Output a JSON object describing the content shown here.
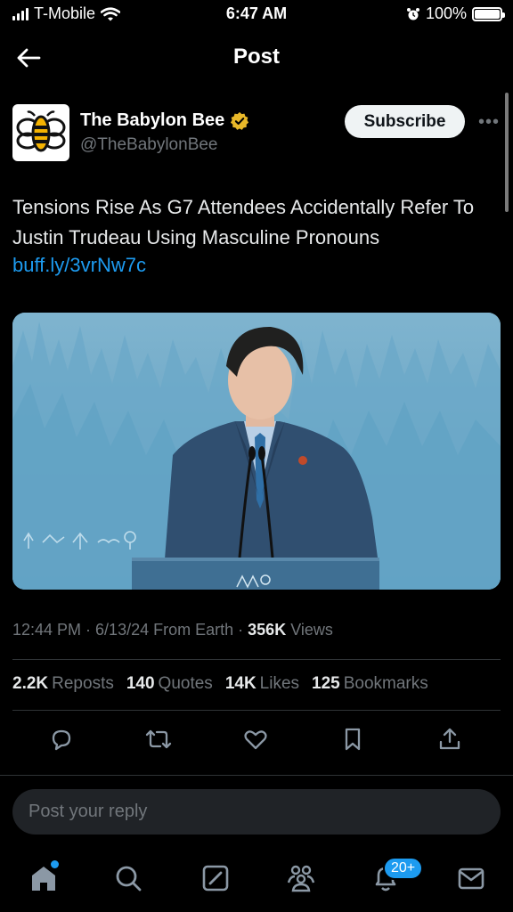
{
  "status_bar": {
    "carrier": "T-Mobile",
    "time": "6:47 AM",
    "battery": "100%"
  },
  "header": {
    "title": "Post"
  },
  "author": {
    "name": "The Babylon Bee",
    "handle": "@TheBabylonBee",
    "subscribe_label": "Subscribe",
    "more_label": "•••"
  },
  "post": {
    "text": "Tensions Rise As G7 Attendees Accidentally Refer To Justin Trudeau Using Masculine Pronouns",
    "link": "buff.ly/3vrNw7c"
  },
  "meta": {
    "time": "12:44 PM",
    "date": "6/13/24",
    "source": "From Earth",
    "views_count": "356K",
    "views_label": "Views"
  },
  "stats": {
    "reposts_count": "2.2K",
    "reposts_label": "Reposts",
    "quotes_count": "140",
    "quotes_label": "Quotes",
    "likes_count": "14K",
    "likes_label": "Likes",
    "bookmarks_count": "125",
    "bookmarks_label": "Bookmarks"
  },
  "reply": {
    "placeholder": "Post your reply"
  },
  "bottom_nav": {
    "notifications_badge": "20+"
  },
  "colors": {
    "accent": "#1d9bf0",
    "background": "#000000",
    "muted": "#71767b",
    "verified": "#e8b829"
  },
  "icons": {
    "back": "arrow-left-icon",
    "verified": "verified-badge-icon",
    "reply": "comment-icon",
    "repost": "repost-icon",
    "like": "heart-icon",
    "bookmark": "bookmark-icon",
    "share": "share-icon",
    "home": "home-icon",
    "search": "search-icon",
    "compose": "compose-icon",
    "communities": "communities-icon",
    "notifications": "bell-icon",
    "messages": "mail-icon"
  }
}
